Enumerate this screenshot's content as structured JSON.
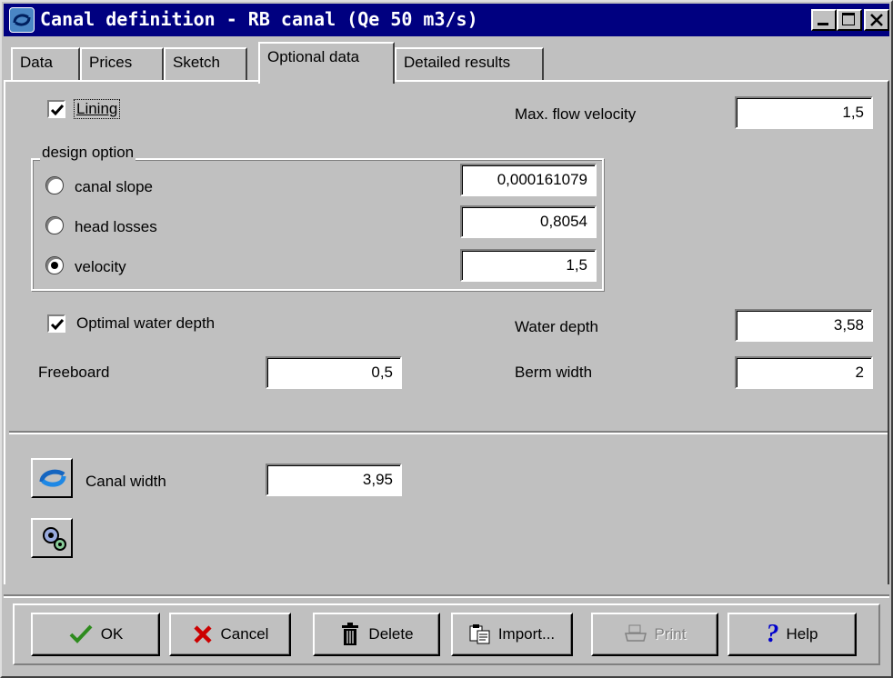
{
  "window": {
    "title": "Canal definition - RB canal (Qe 50 m3/s)"
  },
  "tabs": [
    {
      "label": "Data"
    },
    {
      "label": "Prices"
    },
    {
      "label": "Sketch"
    },
    {
      "label": "Optional data"
    },
    {
      "label": "Detailed results"
    }
  ],
  "lining": {
    "label": "Lining",
    "checked": true
  },
  "max_flow_velocity": {
    "label": "Max. flow velocity",
    "value": "1,5"
  },
  "design_option": {
    "legend": "design option",
    "options": [
      {
        "label": "canal slope",
        "value": "0,000161079",
        "selected": false
      },
      {
        "label": "head losses",
        "value": "0,8054",
        "selected": false
      },
      {
        "label": "velocity",
        "value": "1,5",
        "selected": true
      }
    ]
  },
  "optimal_water_depth": {
    "label": "Optimal water depth",
    "checked": true
  },
  "water_depth": {
    "label": "Water depth",
    "value": "3,58"
  },
  "freeboard": {
    "label": "Freeboard",
    "value": "0,5"
  },
  "berm_width": {
    "label": "Berm width",
    "value": "2"
  },
  "canal_width": {
    "label": "Canal width",
    "value": "3,95"
  },
  "buttons": {
    "ok": "OK",
    "cancel": "Cancel",
    "delete": "Delete",
    "import": "Import...",
    "print": "Print",
    "help": "Help"
  },
  "colors": {
    "titlebar": "#000080",
    "face": "#c0c0c0",
    "ok_check": "#2e8b1e",
    "cancel_x": "#cc0000",
    "help_q": "#0000cc"
  }
}
